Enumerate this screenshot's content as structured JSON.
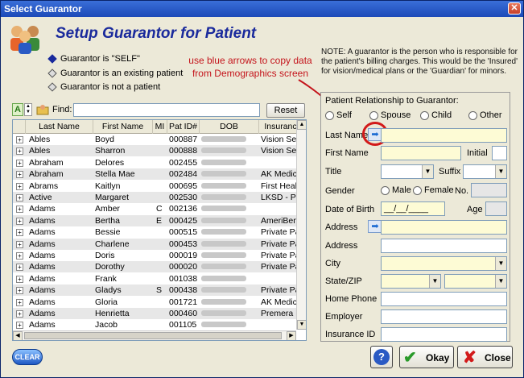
{
  "window": {
    "title": "Select Guarantor",
    "close_glyph": "✕"
  },
  "header": {
    "title": "Setup Guarantor for Patient"
  },
  "note": "NOTE:  A guarantor is the person who is responsible for the patient's billing charges.  This would be the 'Insured' for vision/medical plans or the 'Guardian' for minors.",
  "annotation": {
    "line1": "use blue arrows to copy data",
    "line2": "from Demographics screen"
  },
  "guarantor_options": [
    {
      "label": "Guarantor is \"SELF\"",
      "selected": true
    },
    {
      "label": "Guarantor is an existing patient",
      "selected": false
    },
    {
      "label": "Guarantor is not a patient",
      "selected": false
    }
  ],
  "find": {
    "az_label": "A",
    "label": "Find:",
    "value": "",
    "reset_label": "Reset"
  },
  "grid": {
    "columns": [
      "Last Name",
      "First Name",
      "MI",
      "Pat ID#",
      "DOB",
      "Insuranc"
    ],
    "rows": [
      [
        "Ables",
        "Boyd",
        "",
        "000887",
        "",
        "Vision Service"
      ],
      [
        "Ables",
        "Sharron",
        "",
        "000888",
        "",
        "Vision Service"
      ],
      [
        "Abraham",
        "Delores",
        "",
        "002455",
        "",
        ""
      ],
      [
        "Abraham",
        "Stella Mae",
        "",
        "002484",
        "",
        "AK Medicaid -"
      ],
      [
        "Abrams",
        "Kaitlyn",
        "",
        "000695",
        "",
        "First Health Se"
      ],
      [
        "Active",
        "Margaret",
        "",
        "002530",
        "",
        "LKSD - Premie"
      ],
      [
        "Adams",
        "Amber",
        "C",
        "002136",
        "",
        ""
      ],
      [
        "Adams",
        "Bertha",
        "E",
        "000425",
        "",
        "AmeriBen/IEC G"
      ],
      [
        "Adams",
        "Bessie",
        "",
        "000515",
        "",
        "Private Pay Ca"
      ],
      [
        "Adams",
        "Charlene",
        "",
        "000453",
        "",
        "Private Pay Ca"
      ],
      [
        "Adams",
        "Doris",
        "",
        "000019",
        "",
        "Private Pay Ca"
      ],
      [
        "Adams",
        "Dorothy",
        "",
        "000020",
        "",
        "Private Pay Ca"
      ],
      [
        "Adams",
        "Frank",
        "",
        "001038",
        "",
        ""
      ],
      [
        "Adams",
        "Gladys",
        "S",
        "000438",
        "",
        "Private Pay Ca"
      ],
      [
        "Adams",
        "Gloria",
        "",
        "001721",
        "",
        "AK Medicaid -"
      ],
      [
        "Adams",
        "Henrietta",
        "",
        "000460",
        "",
        "Premera Bluec"
      ],
      [
        "Adams",
        "Jacob",
        "",
        "001105",
        "",
        ""
      ]
    ]
  },
  "form": {
    "relationship_label": "Patient Relationship to Guarantor:",
    "relationship_options": [
      "Self",
      "Spouse",
      "Child",
      "Other"
    ],
    "last_name_label": "Last Name",
    "first_name_label": "First Name",
    "initial_label": "Initial",
    "title_label": "Title",
    "suffix_label": "Suffix",
    "gender_label": "Gender",
    "male_label": "Male",
    "female_label": "Female",
    "no_label": "No.",
    "dob_label": "Date of Birth",
    "dob_value": "__/__/____",
    "age_label": "Age",
    "address_label": "Address",
    "address2_label": "Address",
    "city_label": "City",
    "state_zip_label": "State/ZIP",
    "home_phone_label": "Home Phone",
    "employer_label": "Employer",
    "insurance_id_label": "Insurance ID"
  },
  "buttons": {
    "clear": "CLEAR",
    "help": "?",
    "okay": "Okay",
    "close": "Close"
  },
  "colors": {
    "title_blue": "#1a2a9c",
    "annotation_red": "#c4141b",
    "required_yellow": "#fdfbd5"
  }
}
